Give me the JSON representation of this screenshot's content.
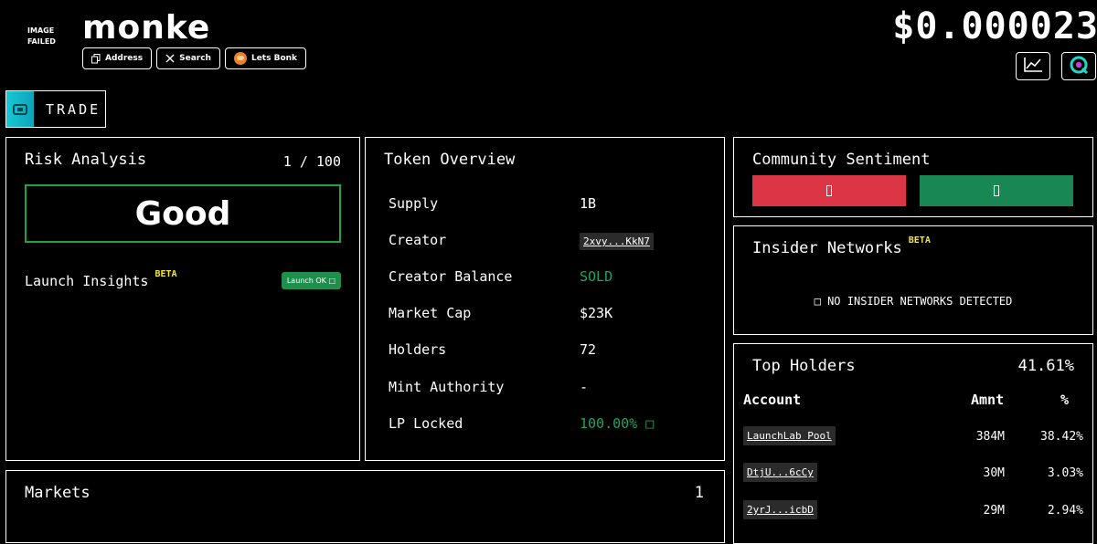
{
  "header": {
    "image_failed": "IMAGE FAILED",
    "token_name": "monke",
    "price": "$0.000023",
    "pills": [
      {
        "label": "Address",
        "icon": "copy-icon"
      },
      {
        "label": "Search",
        "icon": "x-logo-icon"
      },
      {
        "label": "Lets Bonk",
        "icon": "bonk-logo-icon"
      }
    ],
    "chart_icon": "chart-icon",
    "app_icon": "app-logo-icon"
  },
  "trade": {
    "label": "TRADE"
  },
  "risk": {
    "title": "Risk Analysis",
    "score": "1 / 100",
    "rating": "Good",
    "insights_label": "Launch Insights",
    "beta": "BETA",
    "launch_badge": "Launch OK □"
  },
  "overview": {
    "title": "Token Overview",
    "rows": [
      {
        "label": "Supply",
        "value": "1B"
      },
      {
        "label": "Creator",
        "value": "2xvy...KkN7"
      },
      {
        "label": "Creator Balance",
        "value": "SOLD"
      },
      {
        "label": "Market Cap",
        "value": "$23K"
      },
      {
        "label": "Holders",
        "value": "72"
      },
      {
        "label": "Mint Authority",
        "value": "-"
      },
      {
        "label": "LP Locked",
        "value": "100.00% □"
      }
    ]
  },
  "markets": {
    "title": "Markets",
    "count": "1"
  },
  "sentiment": {
    "title": "Community Sentiment"
  },
  "insider": {
    "title": "Insider Networks",
    "beta": "BETA",
    "message": "□  NO INSIDER NETWORKS DETECTED"
  },
  "holders": {
    "title": "Top Holders",
    "total_pct": "41.61%",
    "columns": {
      "account": "Account",
      "amount": "Amnt",
      "pct": "%"
    },
    "rows": [
      {
        "account": "LaunchLab Pool",
        "amount": "384M",
        "pct": "38.42%"
      },
      {
        "account": "DtjU...6cCy",
        "amount": "30M",
        "pct": "3.03%"
      },
      {
        "account": "2yrJ...icbD",
        "amount": "29M",
        "pct": "2.94%"
      }
    ]
  },
  "colors": {
    "good_border": "#22a33b",
    "green_text": "#1fa463",
    "vote_down": "#dc3545",
    "vote_up": "#198754",
    "beta": "#f5e63b",
    "trade_accent": "#18c7d6"
  }
}
